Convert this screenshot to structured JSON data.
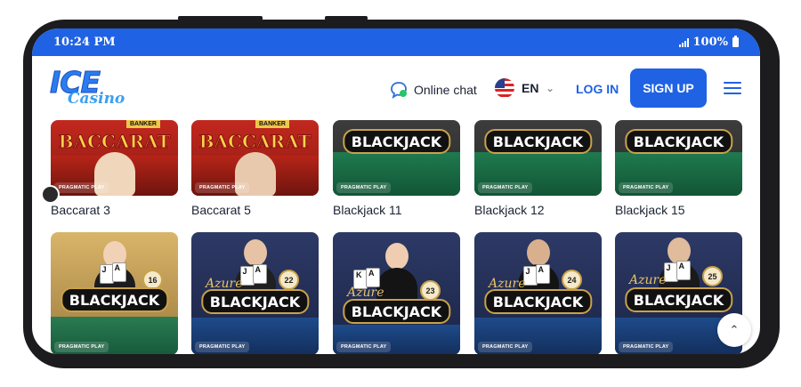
{
  "statusbar": {
    "time": "10:24 PM",
    "battery": "100%"
  },
  "header": {
    "logo_top": "ICE",
    "logo_bottom": "Casino",
    "chat_label": "Online chat",
    "language": "EN",
    "login_label": "LOG IN",
    "signup_label": "SIGN UP"
  },
  "games": [
    {
      "title": "Baccarat 3",
      "logo": "BACCARAT",
      "tag": "BANKER",
      "provider": "PRAGMATIC PLAY",
      "theme": "red"
    },
    {
      "title": "Baccarat 5",
      "logo": "BACCARAT",
      "tag": "BANKER",
      "provider": "PRAGMATIC PLAY",
      "theme": "red"
    },
    {
      "title": "Blackjack 11",
      "logo": "BLACKJACK",
      "provider": "PRAGMATIC PLAY",
      "theme": "green"
    },
    {
      "title": "Blackjack 12",
      "logo": "BLACKJACK",
      "provider": "PRAGMATIC PLAY",
      "theme": "green"
    },
    {
      "title": "Blackjack 15",
      "logo": "BLACKJACK",
      "provider": "PRAGMATIC PLAY",
      "theme": "green"
    },
    {
      "logo": "BLACKJACK",
      "number": "16",
      "provider": "PRAGMATIC PLAY",
      "theme": "gold"
    },
    {
      "logo": "BLACKJACK",
      "sub": "Azure",
      "number": "22",
      "provider": "PRAGMATIC PLAY",
      "theme": "blue"
    },
    {
      "logo": "BLACKJACK",
      "sub": "Azure",
      "number": "23",
      "provider": "PRAGMATIC PLAY",
      "theme": "blue"
    },
    {
      "logo": "BLACKJACK",
      "sub": "Azure",
      "number": "24",
      "provider": "PRAGMATIC PLAY",
      "theme": "blue"
    },
    {
      "logo": "BLACKJACK",
      "sub": "Azure",
      "number": "25",
      "provider": "PRAGMATIC PLAY",
      "theme": "blue"
    }
  ],
  "colors": {
    "brand": "#1f62e3",
    "text": "#1a2233"
  },
  "icons": {
    "chat": "chat-bubble-icon",
    "flag": "us-flag-icon",
    "menu": "hamburger-icon",
    "scroll_top": "chevron-up-icon"
  }
}
